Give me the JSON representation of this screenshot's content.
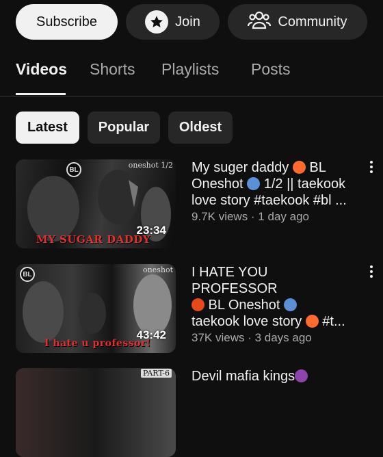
{
  "actions": {
    "subscribe": "Subscribe",
    "join": "Join",
    "community": "Community"
  },
  "tabs": [
    {
      "label": "Videos",
      "active": true
    },
    {
      "label": "Shorts",
      "active": false
    },
    {
      "label": "Playlists",
      "active": false
    },
    {
      "label": "Posts",
      "active": false
    }
  ],
  "chips": [
    {
      "label": "Latest",
      "selected": true
    },
    {
      "label": "Popular",
      "selected": false
    },
    {
      "label": "Oldest",
      "selected": false
    }
  ],
  "videos": [
    {
      "title_line1": "My suger daddy ",
      "title_line2": " BL",
      "title_line3": "Oneshot ",
      "title_line4": " 1/2 || taekook",
      "title_line5": "love story #taekook #bl ...",
      "meta": "9.7K views · 1 day ago",
      "duration": "23:34",
      "badge": "BL",
      "tag": "oneshot 1/2",
      "overlay": "MY SUGAR DADDY"
    },
    {
      "title_line1": "I HATE YOU PROFESSOR",
      "title_line2": " BL Oneshot ",
      "title_line3": "taekook love story ",
      "title_line4": " #t...",
      "meta": "37K views · 3 days ago",
      "duration": "43:42",
      "badge": "BL",
      "tag": "oneshot",
      "overlay": "I hate u professor!"
    },
    {
      "title_line1": "Devil mafia kings",
      "tag": "PART-6"
    }
  ],
  "colors": {
    "background": "#0f0f0f",
    "chip": "#272727",
    "text": "#f1f1f1",
    "secondary_text": "#aaaaaa",
    "overlay_red": "#e03030"
  }
}
